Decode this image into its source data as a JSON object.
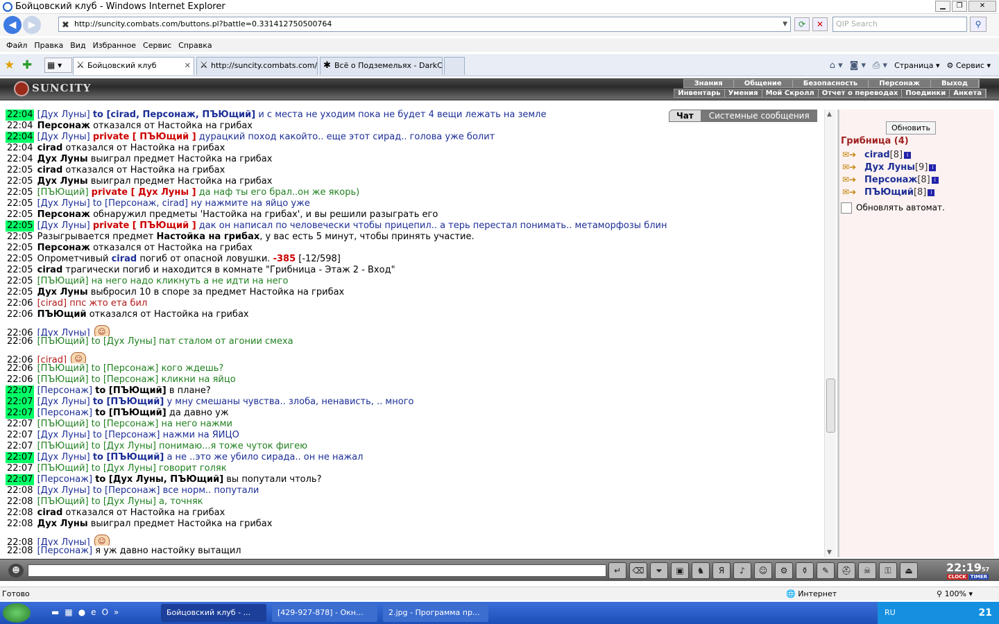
{
  "window": {
    "title": "Бойцовский клуб - Windows Internet Explorer"
  },
  "browser": {
    "url": "http://suncity.combats.com/buttons.pl?battle=0.331412750500764",
    "search_placeholder": "QIP Search",
    "menu": [
      "Файл",
      "Правка",
      "Вид",
      "Избранное",
      "Сервис",
      "Справка"
    ],
    "tabs": [
      {
        "label": "Бойцовский клуб"
      },
      {
        "label": "http://suncity.combats.com/l..."
      },
      {
        "label": "Всё о Подземельях - DarkCl..."
      }
    ],
    "tools": {
      "page": "Страница",
      "service": "Сервис"
    }
  },
  "game": {
    "logo": "SUNCITY",
    "menu_top": [
      "Знания",
      "Общение",
      "Безопасность",
      "Персонаж",
      "Выход"
    ],
    "menu_bottom": [
      "Инвентарь",
      "Умения",
      "Мой Скролл",
      "Отчет о переводах",
      "Поединки",
      "Анкета"
    ]
  },
  "chat_tabs": {
    "chat": "Чат",
    "system": "Системные сообщения"
  },
  "side": {
    "refresh_button": "Обновить",
    "room": "Грибница (4)",
    "users": [
      {
        "name": "cirad",
        "level": "[8]"
      },
      {
        "name": "Дух Луны",
        "level": "[9]"
      },
      {
        "name": "Персонаж",
        "level": "[8]"
      },
      {
        "name": "ПЪЮщий",
        "level": "[8]"
      }
    ],
    "auto_refresh": "Обновлять автомат."
  },
  "chat": {
    "lines": [
      {
        "time": "22:04",
        "hl": true,
        "nick": "[Дух Луны]",
        "to": "to [cirad, Персонаж, ПЪЮщий]",
        "to_bold": true,
        "msg": " и с места не уходим пока не будет 4 вещи лежать на земле",
        "color": "blue"
      },
      {
        "time": "22:04",
        "hl": false,
        "sys_bold": "Персонаж",
        "sys": " отказался от Настойка на грибах"
      },
      {
        "time": "22:04",
        "hl": true,
        "nick": "[Дух Луны]",
        "pm": "private [ ПЪЮщий ]",
        "msg": " дурацкий поход какойто.. еще этот сирад.. голова уже болит",
        "color": "blue"
      },
      {
        "time": "22:04",
        "hl": false,
        "sys_bold": "cirad",
        "sys": " отказался от Настойка на грибах"
      },
      {
        "time": "22:04",
        "hl": false,
        "sys_bold": "Дух Луны",
        "sys": " выиграл предмет Настойка на грибах"
      },
      {
        "time": "22:05",
        "hl": false,
        "sys_bold": "cirad",
        "sys": " отказался от Настойка на грибах"
      },
      {
        "time": "22:05",
        "hl": false,
        "sys_bold": "Дух Луны",
        "sys": " выиграл предмет Настойка на грибах"
      },
      {
        "time": "22:05",
        "hl": false,
        "nick": "[ПЪЮщий]",
        "pm": "private [ Дух Луны ]",
        "msg": " да наф ты его брал..он же якорь)",
        "color": "green"
      },
      {
        "time": "22:05",
        "hl": false,
        "nick": "[Дух Луны]",
        "to": "to [Персонаж, cirad]",
        "msg": " ну нажмите на яйцо уже",
        "color": "blue"
      },
      {
        "time": "22:05",
        "hl": false,
        "sys_bold": "Персонаж",
        "sys": " обнаружил предметы 'Настойка на грибах', и вы решили разыграть его"
      },
      {
        "time": "22:05",
        "hl": true,
        "nick": "[Дух Луны]",
        "pm": "private [ ПЪЮщий ]",
        "msg": " дак он написал по человечески чтобы прицепил.. а терь перестал понимать.. метаморфозы блин",
        "color": "blue"
      },
      {
        "time": "22:05",
        "hl": false,
        "sys": "Разыгрывается предмет ",
        "sys_bold2": "Настойка на грибах",
        "sys2": ", у вас есть 5 минут, чтобы принять участие."
      },
      {
        "time": "22:05",
        "hl": false,
        "sys_bold": "Персонаж",
        "sys": " отказался от Настойка на грибах"
      },
      {
        "time": "22:05",
        "hl": false,
        "trap": true,
        "pre": "Опрометчивый ",
        "victim": "cirad",
        "mid": " погиб от опасной ловушки. ",
        "dmg": "-385",
        "post": " [-12/598]"
      },
      {
        "time": "22:05",
        "hl": false,
        "sys_bold": "cirad",
        "sys": " трагически погиб и находится в комнате \"Грибница - Этаж 2 - Вход\""
      },
      {
        "time": "22:05",
        "hl": false,
        "nick": "[ПЪЮщий]",
        "msg": " на него надо кликнуть а не идти на него",
        "color": "green"
      },
      {
        "time": "22:05",
        "hl": false,
        "sys_bold": "Дух Луны",
        "sys": " выбросил 10 в споре за предмет Настойка на грибах"
      },
      {
        "time": "22:06",
        "hl": false,
        "nick": "[cirad]",
        "msg": " ппс жто ета бил",
        "color": "red"
      },
      {
        "time": "22:06",
        "hl": false,
        "sys_bold": "ПЪЮщий",
        "sys": " отказался от Настойка на грибах"
      },
      {
        "time": "22:06",
        "hl": false,
        "nick": "[Дух Луны]",
        "smile": true,
        "color": "blue"
      },
      {
        "time": "22:06",
        "hl": false,
        "nick": "[ПЪЮщий]",
        "to": "to [Дух Луны]",
        "msg": " пат сталом от агонии смеха",
        "color": "green"
      },
      {
        "time": "22:06",
        "hl": false,
        "nick": "[cirad]",
        "smile": true,
        "color": "red"
      },
      {
        "time": "22:06",
        "hl": false,
        "nick": "[ПЪЮщий]",
        "to": "to [Персонаж]",
        "msg": " кого ждешь?",
        "color": "green"
      },
      {
        "time": "22:06",
        "hl": false,
        "nick": "[ПЪЮщий]",
        "to": "to [Персонаж]",
        "msg": " кликни на яйцо",
        "color": "green"
      },
      {
        "time": "22:07",
        "hl": true,
        "nick": "[Персонаж]",
        "to": "to [ПЪЮщий]",
        "to_bold": true,
        "to_black": true,
        "msg": " в плане?",
        "color": "black"
      },
      {
        "time": "22:07",
        "hl": true,
        "nick": "[Дух Луны]",
        "to": "to [ПЪЮщий]",
        "to_bold": true,
        "msg": " у мну смешаны чувства.. злоба, ненависть, .. много",
        "color": "blue"
      },
      {
        "time": "22:07",
        "hl": true,
        "nick": "[Персонаж]",
        "to": "to [ПЪЮщий]",
        "to_bold": true,
        "to_black": true,
        "msg": " да давно уж",
        "color": "black"
      },
      {
        "time": "22:07",
        "hl": false,
        "nick": "[ПЪЮщий]",
        "to": "to [Персонаж]",
        "msg": " на него нажми",
        "color": "green"
      },
      {
        "time": "22:07",
        "hl": false,
        "nick": "[Дух Луны]",
        "to": "to [Персонаж]",
        "msg": " нажми на ЯЙЦО",
        "color": "blue"
      },
      {
        "time": "22:07",
        "hl": false,
        "nick": "[ПЪЮщий]",
        "to": "to [Дух Луны]",
        "msg": " понимаю...я тоже чуток фигею",
        "color": "green"
      },
      {
        "time": "22:07",
        "hl": true,
        "nick": "[Дух Луны]",
        "to": "to [ПЪЮщий]",
        "to_bold": true,
        "msg": " а не ..это же убило сирада.. он не нажал",
        "color": "blue"
      },
      {
        "time": "22:07",
        "hl": false,
        "nick": "[ПЪЮщий]",
        "to": "to [Дух Луны]",
        "msg": " говорит голяк",
        "color": "green"
      },
      {
        "time": "22:07",
        "hl": true,
        "nick": "[Персонаж]",
        "to": "to [Дух Луны, ПЪЮщий]",
        "to_bold": true,
        "to_black": true,
        "msg": " вы попутали чтоль?",
        "color": "black"
      },
      {
        "time": "22:08",
        "hl": false,
        "nick": "[Дух Луны]",
        "to": "to [Персонаж]",
        "msg": " все норм.. попутали",
        "color": "blue"
      },
      {
        "time": "22:08",
        "hl": false,
        "nick": "[ПЪЮщий]",
        "to": "to [Дух Луны]",
        "msg": " а, точняк",
        "color": "green"
      },
      {
        "time": "22:08",
        "hl": false,
        "sys_bold": "cirad",
        "sys": " отказался от Настойка на грибах"
      },
      {
        "time": "22:08",
        "hl": false,
        "sys_bold": "Дух Луны",
        "sys": " выиграл предмет Настойка на грибах"
      },
      {
        "time": "22:08",
        "hl": false,
        "nick": "[Дух Луны]",
        "smile": true,
        "color": "blue"
      },
      {
        "time": "22:08",
        "hl": false,
        "nick": "[Персонаж]",
        "msg": " я уж давно настойку вытащил",
        "color": "black"
      }
    ]
  },
  "clock": {
    "time": "22:19",
    "sec": "57",
    "clock_label": "CLOCK",
    "timer_label": "TIMER"
  },
  "status": {
    "left": "Готово",
    "zone": "Интернет",
    "zoom": "100%"
  },
  "taskbar": {
    "tasks": [
      "Бойцовский клуб - ...",
      "[429-927-878] - Окн...",
      "2.jpg - Программа пр..."
    ],
    "lang": "RU",
    "time": "21"
  },
  "colors": {
    "time_highlight": "#00ff66",
    "blue": "#1c2e96",
    "green": "#208020",
    "red": "#b31616",
    "private": "#cc0000"
  }
}
